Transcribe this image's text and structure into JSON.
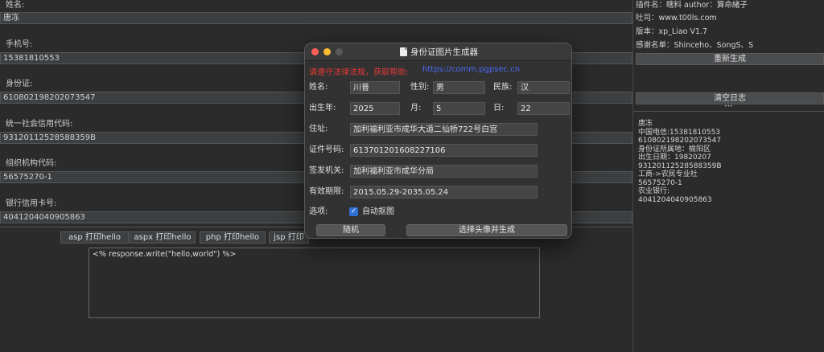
{
  "left_panel": {
    "fields": [
      {
        "label": "姓名:",
        "value": "唐冻"
      },
      {
        "label": "手机号:",
        "value": "15381810553"
      },
      {
        "label": "身份证:",
        "value": "610802198202073547"
      },
      {
        "label": "统一社会信用代码:",
        "value": "93120112528588359B"
      },
      {
        "label": "组织机构代码:",
        "value": "56575270-1"
      },
      {
        "label": "银行信用卡号:",
        "value": "4041204040905863"
      }
    ],
    "buttons": [
      "asp 打印hello",
      "aspx 打印hello",
      "php 打印hello",
      "jsp 打印"
    ],
    "code_text": "<% response.write(\"hello,world\") %>"
  },
  "right_panel": {
    "plugin_info": "插件名：瞎料 author：算命緒子",
    "website": "吐司：www.t00ls.com",
    "version": "版本：xp_Liao V1.7",
    "thanks": "感谢名单：Shinceho、SongS、S",
    "regen_button": "重新生成",
    "clear_button": "清空日志",
    "grip": "•••",
    "log_lines": [
      "唐冻",
      "中国电信:15381810553",
      "610802198202073547",
      "身份证所属地：榆阳区",
      "出生日期：19820207",
      "93120112528588359B",
      "工商->农民专业社",
      "56575270-1",
      "农业银行:",
      "4041204040905863"
    ]
  },
  "dialog": {
    "title": "身份证图片生成器",
    "warning": "请遵守法律法规，获取帮助:",
    "link": "https://comm.pgpsec.cn",
    "name_label": "姓名:",
    "name_value": "川普",
    "gender_label": "性别:",
    "gender_value": "男",
    "ethnicity_label": "民族:",
    "ethnicity_value": "汉",
    "birth_year_label": "出生年:",
    "birth_year_value": "2025",
    "month_label": "月:",
    "month_value": "5",
    "day_label": "日:",
    "day_value": "22",
    "address_label": "住址:",
    "address_value": "加利福利亚市成华大道二仙桥722号白宫",
    "id_label": "证件号码:",
    "id_value": "613701201608227106",
    "issuer_label": "签发机关:",
    "issuer_value": "加利福利亚市成华分局",
    "validity_label": "有效期限:",
    "validity_value": "2015.05.29-2035.05.24",
    "options_label": "选项:",
    "auto_crop_label": "自动抠图",
    "auto_crop_checked": true,
    "check_glyph": "✓",
    "random_button": "随机",
    "generate_button": "选择头像并生成"
  }
}
